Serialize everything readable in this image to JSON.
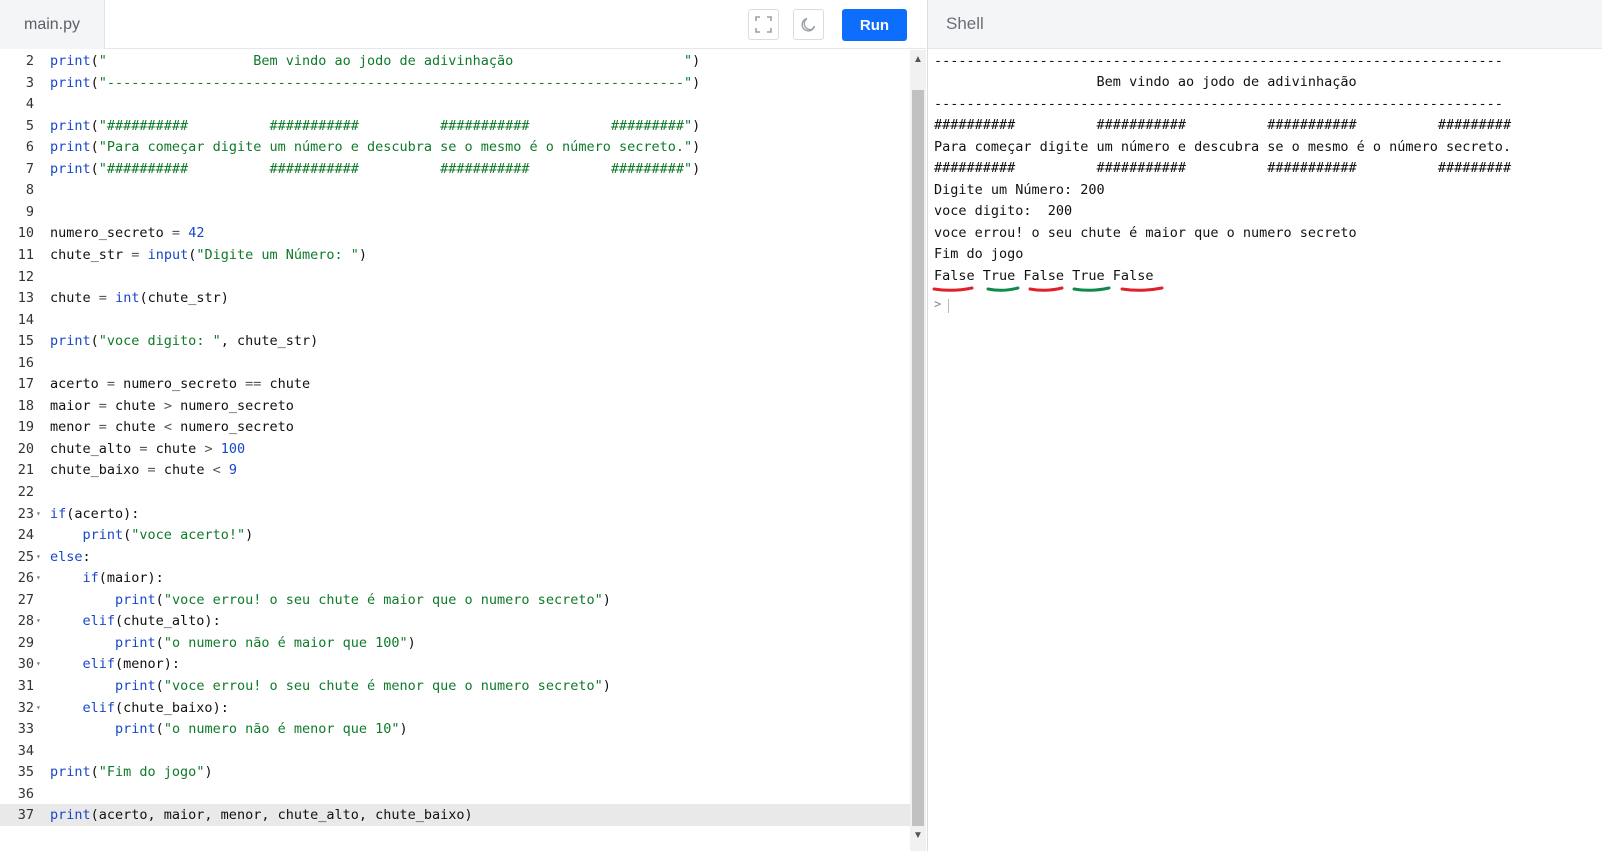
{
  "editor": {
    "filename": "main.py",
    "run_label": "Run",
    "lines": [
      {
        "n": "2",
        "fold": false,
        "html": "<span class='kw'>print</span>(<span class='str'>\"                  Bem vindo ao jodo de adivinhação                     \"</span>)"
      },
      {
        "n": "3",
        "fold": false,
        "html": "<span class='kw'>print</span>(<span class='str'>\"-----------------------------------------------------------------------\"</span>)"
      },
      {
        "n": "4",
        "fold": false,
        "html": ""
      },
      {
        "n": "5",
        "fold": false,
        "html": "<span class='kw'>print</span>(<span class='str'>\"##########          ###########          ###########          #########\"</span>)"
      },
      {
        "n": "6",
        "fold": false,
        "html": "<span class='kw'>print</span>(<span class='str'>\"Para começar digite um número e descubra se o mesmo é o número secreto.\"</span>)"
      },
      {
        "n": "7",
        "fold": false,
        "html": "<span class='kw'>print</span>(<span class='str'>\"##########          ###########          ###########          #########\"</span>)"
      },
      {
        "n": "8",
        "fold": false,
        "html": ""
      },
      {
        "n": "9",
        "fold": false,
        "html": ""
      },
      {
        "n": "10",
        "fold": false,
        "html": "numero_secreto <span class='op'>=</span> <span class='num'>42</span>"
      },
      {
        "n": "11",
        "fold": false,
        "html": "chute_str <span class='op'>=</span> <span class='kw'>input</span>(<span class='str'>\"Digite um Número: \"</span>)"
      },
      {
        "n": "12",
        "fold": false,
        "html": ""
      },
      {
        "n": "13",
        "fold": false,
        "html": "chute <span class='op'>=</span> <span class='kw'>int</span>(chute_str)"
      },
      {
        "n": "14",
        "fold": false,
        "html": ""
      },
      {
        "n": "15",
        "fold": false,
        "html": "<span class='kw'>print</span>(<span class='str'>\"voce digito: \"</span>, chute_str)"
      },
      {
        "n": "16",
        "fold": false,
        "html": ""
      },
      {
        "n": "17",
        "fold": false,
        "html": "acerto <span class='op'>=</span> numero_secreto <span class='op'>==</span> chute"
      },
      {
        "n": "18",
        "fold": false,
        "html": "maior <span class='op'>=</span> chute <span class='op'>&gt;</span> numero_secreto"
      },
      {
        "n": "19",
        "fold": false,
        "html": "menor <span class='op'>=</span> chute <span class='op'>&lt;</span> numero_secreto"
      },
      {
        "n": "20",
        "fold": false,
        "html": "chute_alto <span class='op'>=</span> chute <span class='op'>&gt;</span> <span class='num'>100</span>"
      },
      {
        "n": "21",
        "fold": false,
        "html": "chute_baixo <span class='op'>=</span> chute <span class='op'>&lt;</span> <span class='num'>9</span>"
      },
      {
        "n": "22",
        "fold": false,
        "html": ""
      },
      {
        "n": "23",
        "fold": true,
        "html": "<span class='kw'>if</span>(acerto):"
      },
      {
        "n": "24",
        "fold": false,
        "html": "    <span class='kw'>print</span>(<span class='str'>\"voce acerto!\"</span>)"
      },
      {
        "n": "25",
        "fold": true,
        "html": "<span class='kw'>else</span>:"
      },
      {
        "n": "26",
        "fold": true,
        "html": "    <span class='kw'>if</span>(maior):"
      },
      {
        "n": "27",
        "fold": false,
        "html": "        <span class='kw'>print</span>(<span class='str'>\"voce errou! o seu chute é maior que o numero secreto\"</span>)"
      },
      {
        "n": "28",
        "fold": true,
        "html": "    <span class='kw'>elif</span>(chute_alto):"
      },
      {
        "n": "29",
        "fold": false,
        "html": "        <span class='kw'>print</span>(<span class='str'>\"o numero não é maior que 100\"</span>)"
      },
      {
        "n": "30",
        "fold": true,
        "html": "    <span class='kw'>elif</span>(menor):"
      },
      {
        "n": "31",
        "fold": false,
        "html": "        <span class='kw'>print</span>(<span class='str'>\"voce errou! o seu chute é menor que o numero secreto\"</span>)"
      },
      {
        "n": "32",
        "fold": true,
        "html": "    <span class='kw'>elif</span>(chute_baixo):"
      },
      {
        "n": "33",
        "fold": false,
        "html": "        <span class='kw'>print</span>(<span class='str'>\"o numero não é menor que 10\"</span>)"
      },
      {
        "n": "34",
        "fold": false,
        "html": ""
      },
      {
        "n": "35",
        "fold": false,
        "html": "<span class='kw'>print</span>(<span class='str'>\"Fim do jogo\"</span>)"
      },
      {
        "n": "36",
        "fold": false,
        "html": ""
      },
      {
        "n": "37",
        "fold": false,
        "active": true,
        "html": "<span class='kw'>print</span>(acerto, maior, menor, chute_alto, chute_baixo)"
      }
    ]
  },
  "shell": {
    "title": "Shell",
    "output": [
      "----------------------------------------------------------------------",
      "                    Bem vindo ao jodo de adivinhação",
      "----------------------------------------------------------------------",
      "##########          ###########          ###########          #########",
      "Para começar digite um número e descubra se o mesmo é o número secreto.",
      "##########          ###########          ###########          #########",
      "Digite um Número: 200",
      "voce digito:  200",
      "voce errou! o seu chute é maior que o numero secreto",
      "Fim do jogo",
      "False True False True False"
    ],
    "prompt": ">",
    "underline_colors": [
      "#e0202a",
      "#0f8a4a",
      "#e0202a",
      "#0f8a4a",
      "#e0202a"
    ]
  }
}
